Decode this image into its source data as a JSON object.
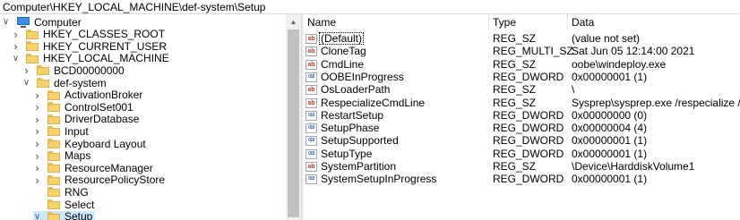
{
  "address": "Computer\\HKEY_LOCAL_MACHINE\\def-system\\Setup",
  "tree": [
    {
      "label": "Computer",
      "expanded": true,
      "type": "computer"
    },
    {
      "label": "HKEY_CLASSES_ROOT",
      "expanded": false
    },
    {
      "label": "HKEY_CURRENT_USER",
      "expanded": false
    },
    {
      "label": "HKEY_LOCAL_MACHINE",
      "expanded": true
    },
    {
      "label": "BCD00000000",
      "expanded": false
    },
    {
      "label": "def-system",
      "expanded": true
    },
    {
      "label": "ActivationBroker",
      "expanded": false
    },
    {
      "label": "ControlSet001",
      "expanded": false
    },
    {
      "label": "DriverDatabase",
      "expanded": false
    },
    {
      "label": "Input",
      "expanded": false
    },
    {
      "label": "Keyboard Layout",
      "expanded": false
    },
    {
      "label": "Maps",
      "expanded": false
    },
    {
      "label": "ResourceManager",
      "expanded": false
    },
    {
      "label": "ResourcePolicyStore",
      "expanded": false
    },
    {
      "label": "RNG",
      "expanded": null
    },
    {
      "label": "Select",
      "expanded": null
    },
    {
      "label": "Setup",
      "expanded": true,
      "selected": true
    }
  ],
  "columns": {
    "name": "Name",
    "type": "Type",
    "data": "Data"
  },
  "rows": [
    {
      "icon": "string-value-icon",
      "name": "(Default)",
      "type": "REG_SZ",
      "data": "(value not set)"
    },
    {
      "icon": "string-value-icon",
      "name": "CloneTag",
      "type": "REG_MULTI_SZ",
      "data": "Sat Jun 05 12:14:00 2021"
    },
    {
      "icon": "string-value-icon",
      "name": "CmdLine",
      "type": "REG_SZ",
      "data": "oobe\\windeploy.exe"
    },
    {
      "icon": "binary-value-icon",
      "name": "OOBEInProgress",
      "type": "REG_DWORD",
      "data": "0x00000001 (1)"
    },
    {
      "icon": "string-value-icon",
      "name": "OsLoaderPath",
      "type": "REG_SZ",
      "data": "\\"
    },
    {
      "icon": "string-value-icon",
      "name": "RespecializeCmdLine",
      "type": "REG_SZ",
      "data": "Sysprep\\sysprep.exe /respecialize /quiet"
    },
    {
      "icon": "binary-value-icon",
      "name": "RestartSetup",
      "type": "REG_DWORD",
      "data": "0x00000000 (0)"
    },
    {
      "icon": "binary-value-icon",
      "name": "SetupPhase",
      "type": "REG_DWORD",
      "data": "0x00000004 (4)"
    },
    {
      "icon": "binary-value-icon",
      "name": "SetupSupported",
      "type": "REG_DWORD",
      "data": "0x00000001 (1)"
    },
    {
      "icon": "binary-value-icon",
      "name": "SetupType",
      "type": "REG_DWORD",
      "data": "0x00000001 (1)"
    },
    {
      "icon": "string-value-icon",
      "name": "SystemPartition",
      "type": "REG_SZ",
      "data": "\\Device\\HarddiskVolume1"
    },
    {
      "icon": "binary-value-icon",
      "name": "SystemSetupInProgress",
      "type": "REG_DWORD",
      "data": "0x00000001 (1)"
    }
  ],
  "icon_glyphs": {
    "string": "ab",
    "binary": "010"
  },
  "colors": {
    "selection": "#cce8ff",
    "folder": "#f7d26a"
  }
}
